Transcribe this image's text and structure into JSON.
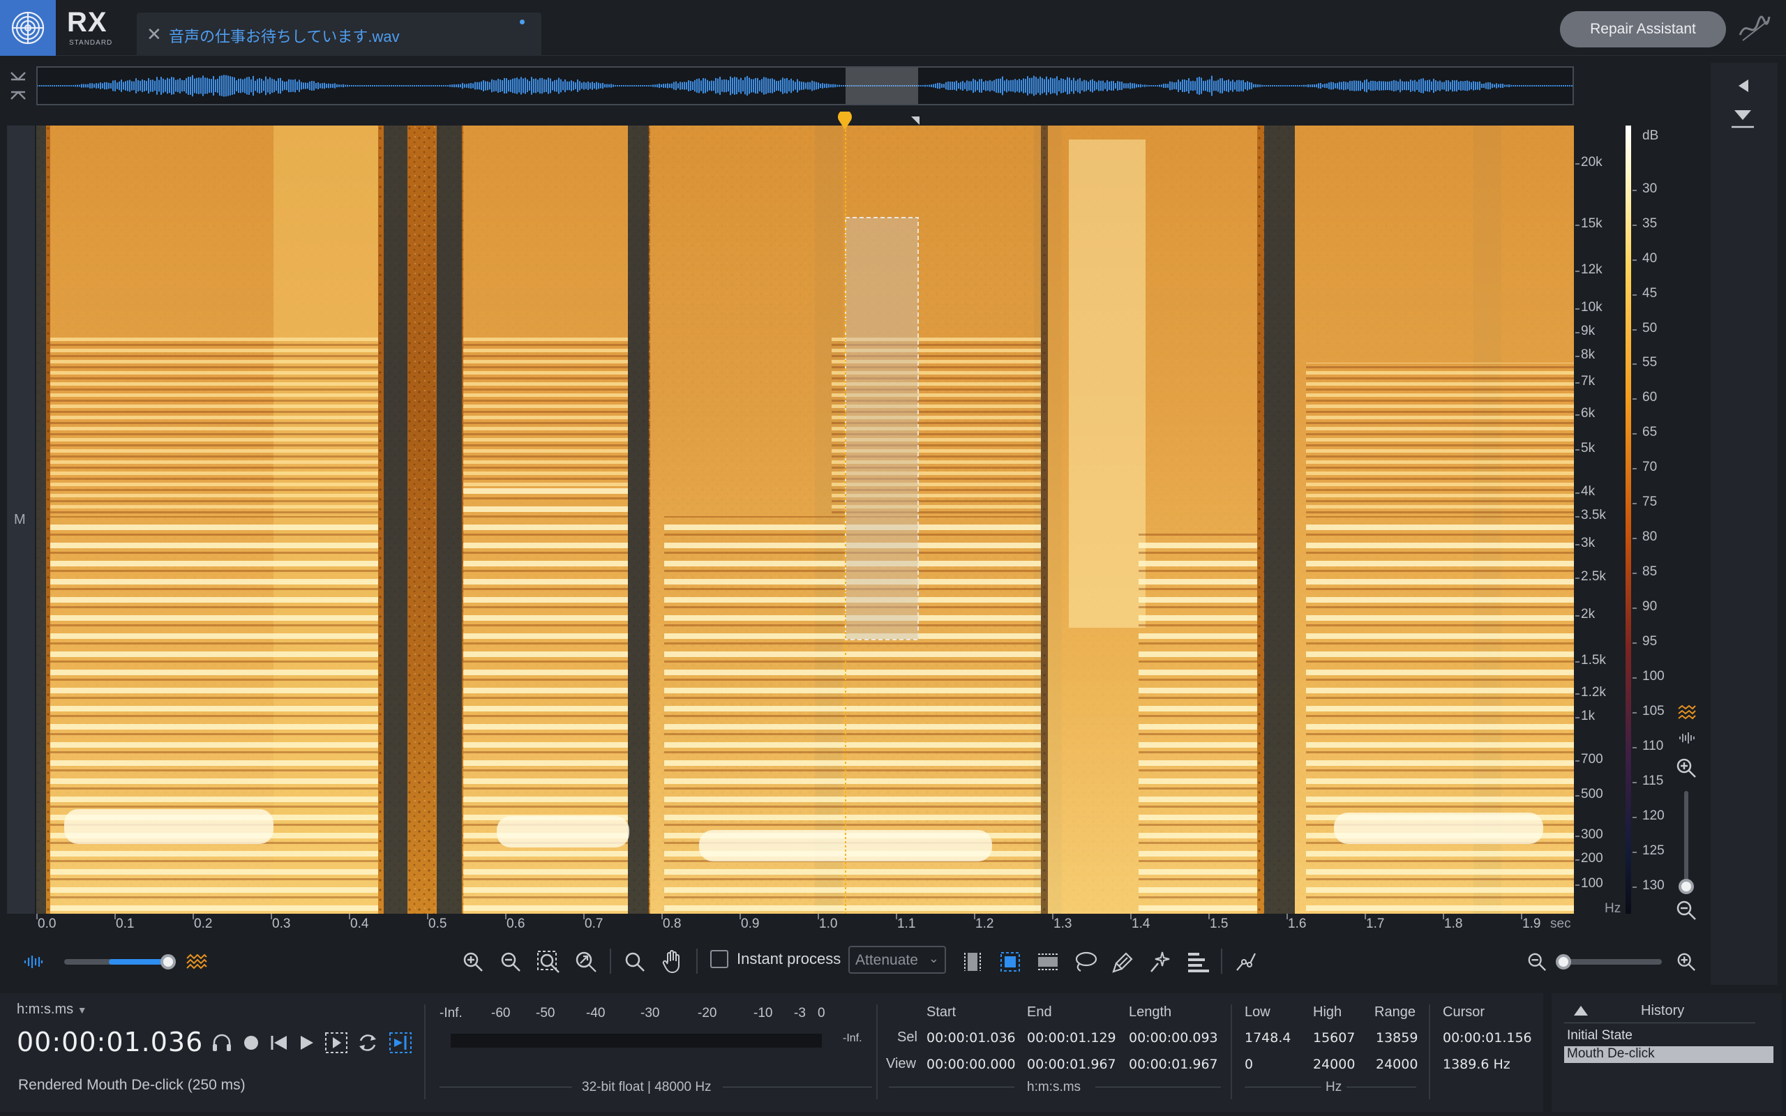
{
  "app": {
    "brand": "RX",
    "edition": "STANDARD",
    "file_tab": "音声の仕事お待ちしています.wav",
    "repair_button": "Repair Assistant"
  },
  "spectrogram": {
    "channel_label": "M",
    "freq_unit": "Hz",
    "db_unit": "dB",
    "time_unit": "sec",
    "freq_labels": [
      "20k",
      "15k",
      "12k",
      "10k",
      "9k",
      "8k",
      "7k",
      "6k",
      "5k",
      "4k",
      "3.5k",
      "3k",
      "2.5k",
      "2k",
      "1.5k",
      "1.2k",
      "1k",
      "700",
      "500",
      "300",
      "200",
      "100"
    ],
    "db_labels": [
      "30",
      "35",
      "40",
      "45",
      "50",
      "55",
      "60",
      "65",
      "70",
      "75",
      "80",
      "85",
      "90",
      "95",
      "100",
      "105",
      "110",
      "115",
      "120",
      "125",
      "130"
    ],
    "time_labels": [
      "0.0",
      "0.1",
      "0.2",
      "0.3",
      "0.4",
      "0.5",
      "0.6",
      "0.7",
      "0.8",
      "0.9",
      "1.0",
      "1.1",
      "1.2",
      "1.3",
      "1.4",
      "1.5",
      "1.6",
      "1.7",
      "1.8",
      "1.9"
    ]
  },
  "toolbar": {
    "instant_process": "Instant process",
    "instant_checked": false,
    "mode": "Attenuate",
    "active_selection_tool": "time-frequency"
  },
  "transport": {
    "time_format": "h:m:s.ms",
    "current_time": "00:00:01.036",
    "status": "Rendered Mouth De-click (250 ms)"
  },
  "meter": {
    "labels": [
      "-Inf.",
      "-60",
      "-50",
      "-40",
      "-30",
      "-20",
      "-10",
      "-3",
      "0"
    ],
    "inf_right": "-Inf.",
    "format": "32-bit float | 48000 Hz"
  },
  "selection": {
    "columns": [
      "Start",
      "End",
      "Length"
    ],
    "rows": [
      {
        "label": "Sel",
        "start": "00:00:01.036",
        "end": "00:00:01.129",
        "length": "00:00:00.093"
      },
      {
        "label": "View",
        "start": "00:00:00.000",
        "end": "00:00:01.967",
        "length": "00:00:01.967"
      }
    ],
    "caption": "h:m:s.ms"
  },
  "frequency": {
    "columns": [
      "Low",
      "High",
      "Range"
    ],
    "rows": [
      {
        "low": "1748.4",
        "high": "15607",
        "range": "13859"
      },
      {
        "low": "0",
        "high": "24000",
        "range": "24000"
      }
    ],
    "caption": "Hz"
  },
  "cursor": {
    "label": "Cursor",
    "time": "00:00:01.156",
    "freq": "1389.6 Hz"
  },
  "history": {
    "title": "History",
    "items": [
      "Initial State",
      "Mouth De-click"
    ],
    "selected": 1
  },
  "colors": {
    "accent": "#2e8ff0",
    "playhead": "#f5b41e"
  }
}
